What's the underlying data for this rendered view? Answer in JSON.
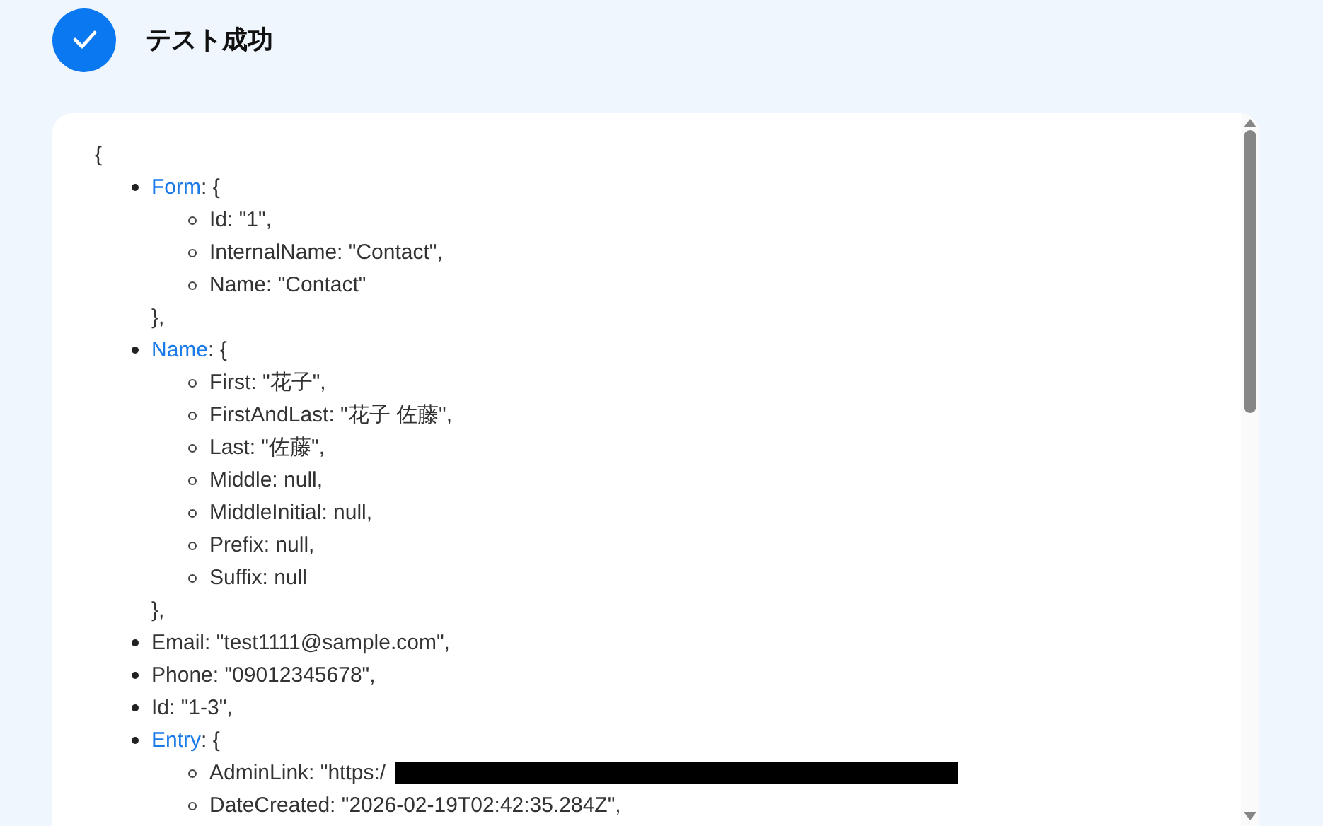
{
  "header": {
    "title": "テスト成功"
  },
  "result": {
    "open": "{",
    "items": [
      {
        "kind": "object",
        "key": "Form",
        "open": ": {",
        "close": "},",
        "children": [
          {
            "kind": "value",
            "text": "Id: \"1\","
          },
          {
            "kind": "value",
            "text": "InternalName: \"Contact\","
          },
          {
            "kind": "value",
            "text": "Name: \"Contact\""
          }
        ]
      },
      {
        "kind": "object",
        "key": "Name",
        "open": ": {",
        "close": "},",
        "children": [
          {
            "kind": "value",
            "text": "First: \"花子\","
          },
          {
            "kind": "value",
            "text": "FirstAndLast: \"花子 佐藤\","
          },
          {
            "kind": "value",
            "text": "Last: \"佐藤\","
          },
          {
            "kind": "value",
            "text": "Middle: null,"
          },
          {
            "kind": "value",
            "text": "MiddleInitial: null,"
          },
          {
            "kind": "value",
            "text": "Prefix: null,"
          },
          {
            "kind": "value",
            "text": "Suffix: null"
          }
        ]
      },
      {
        "kind": "value",
        "text": "Email: \"test1111@sample.com\","
      },
      {
        "kind": "value",
        "text": "Phone: \"09012345678\","
      },
      {
        "kind": "value",
        "text": "Id: \"1-3\","
      },
      {
        "kind": "object",
        "key": "Entry",
        "open": ": {",
        "children": [
          {
            "kind": "redacted",
            "text": "AdminLink: \"https:/"
          },
          {
            "kind": "value",
            "text": "DateCreated: \"2026-02-19T02:42:35.284Z\","
          }
        ]
      }
    ]
  }
}
